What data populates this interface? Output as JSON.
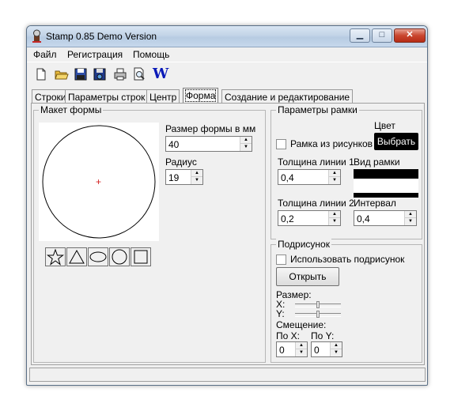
{
  "window": {
    "title": "Stamp 0.85 Demo Version"
  },
  "titlebar_buttons": {
    "minimize": "▁",
    "maximize": "□",
    "close": "✕"
  },
  "menu": [
    "Файл",
    "Регистрация",
    "Помощь"
  ],
  "toolbar": {
    "icons": [
      "new-file-icon",
      "open-folder-icon",
      "save-icon",
      "save-as-icon",
      "print-icon",
      "print-preview-icon"
    ],
    "word_label": "W"
  },
  "tabs": [
    "Строки",
    "Параметры строк",
    "Центр",
    "Форма",
    "Создание и редактирование"
  ],
  "active_tab": "Форма",
  "maket": {
    "title": "Макет формы",
    "center_mark": "+",
    "size_label": "Размер формы в мм",
    "size_value": "40",
    "radius_label": "Радиус",
    "radius_value": "19",
    "shapes": [
      "star-shape",
      "triangle-shape",
      "ellipse-shape",
      "circle-shape",
      "square-shape"
    ]
  },
  "frame": {
    "title": "Параметры рамки",
    "color_label": "Цвет",
    "choose_button": "Выбрать",
    "frame_from_pics": "Рамка из рисунков",
    "line1_label": "Толщина линии 1",
    "line1_value": "0,4",
    "view_label": "Вид рамки",
    "line2_label": "Толщина линии 2",
    "line2_value": "0,2",
    "interval_label": "Интервал",
    "interval_value": "0,4",
    "colors": {
      "accent": "#000000"
    }
  },
  "picture": {
    "title": "Подрисунок",
    "use_label": "Использовать подрисунок",
    "open_button": "Открыть",
    "size_label": "Размер:",
    "x_label": "X:",
    "y_label": "Y:",
    "offset_label": "Смещение:",
    "offset_x_label": "По X:",
    "offset_y_label": "По Y:",
    "offset_x_value": "0",
    "offset_y_value": "0"
  },
  "spin_arrows": {
    "up": "▲",
    "down": "▼"
  }
}
